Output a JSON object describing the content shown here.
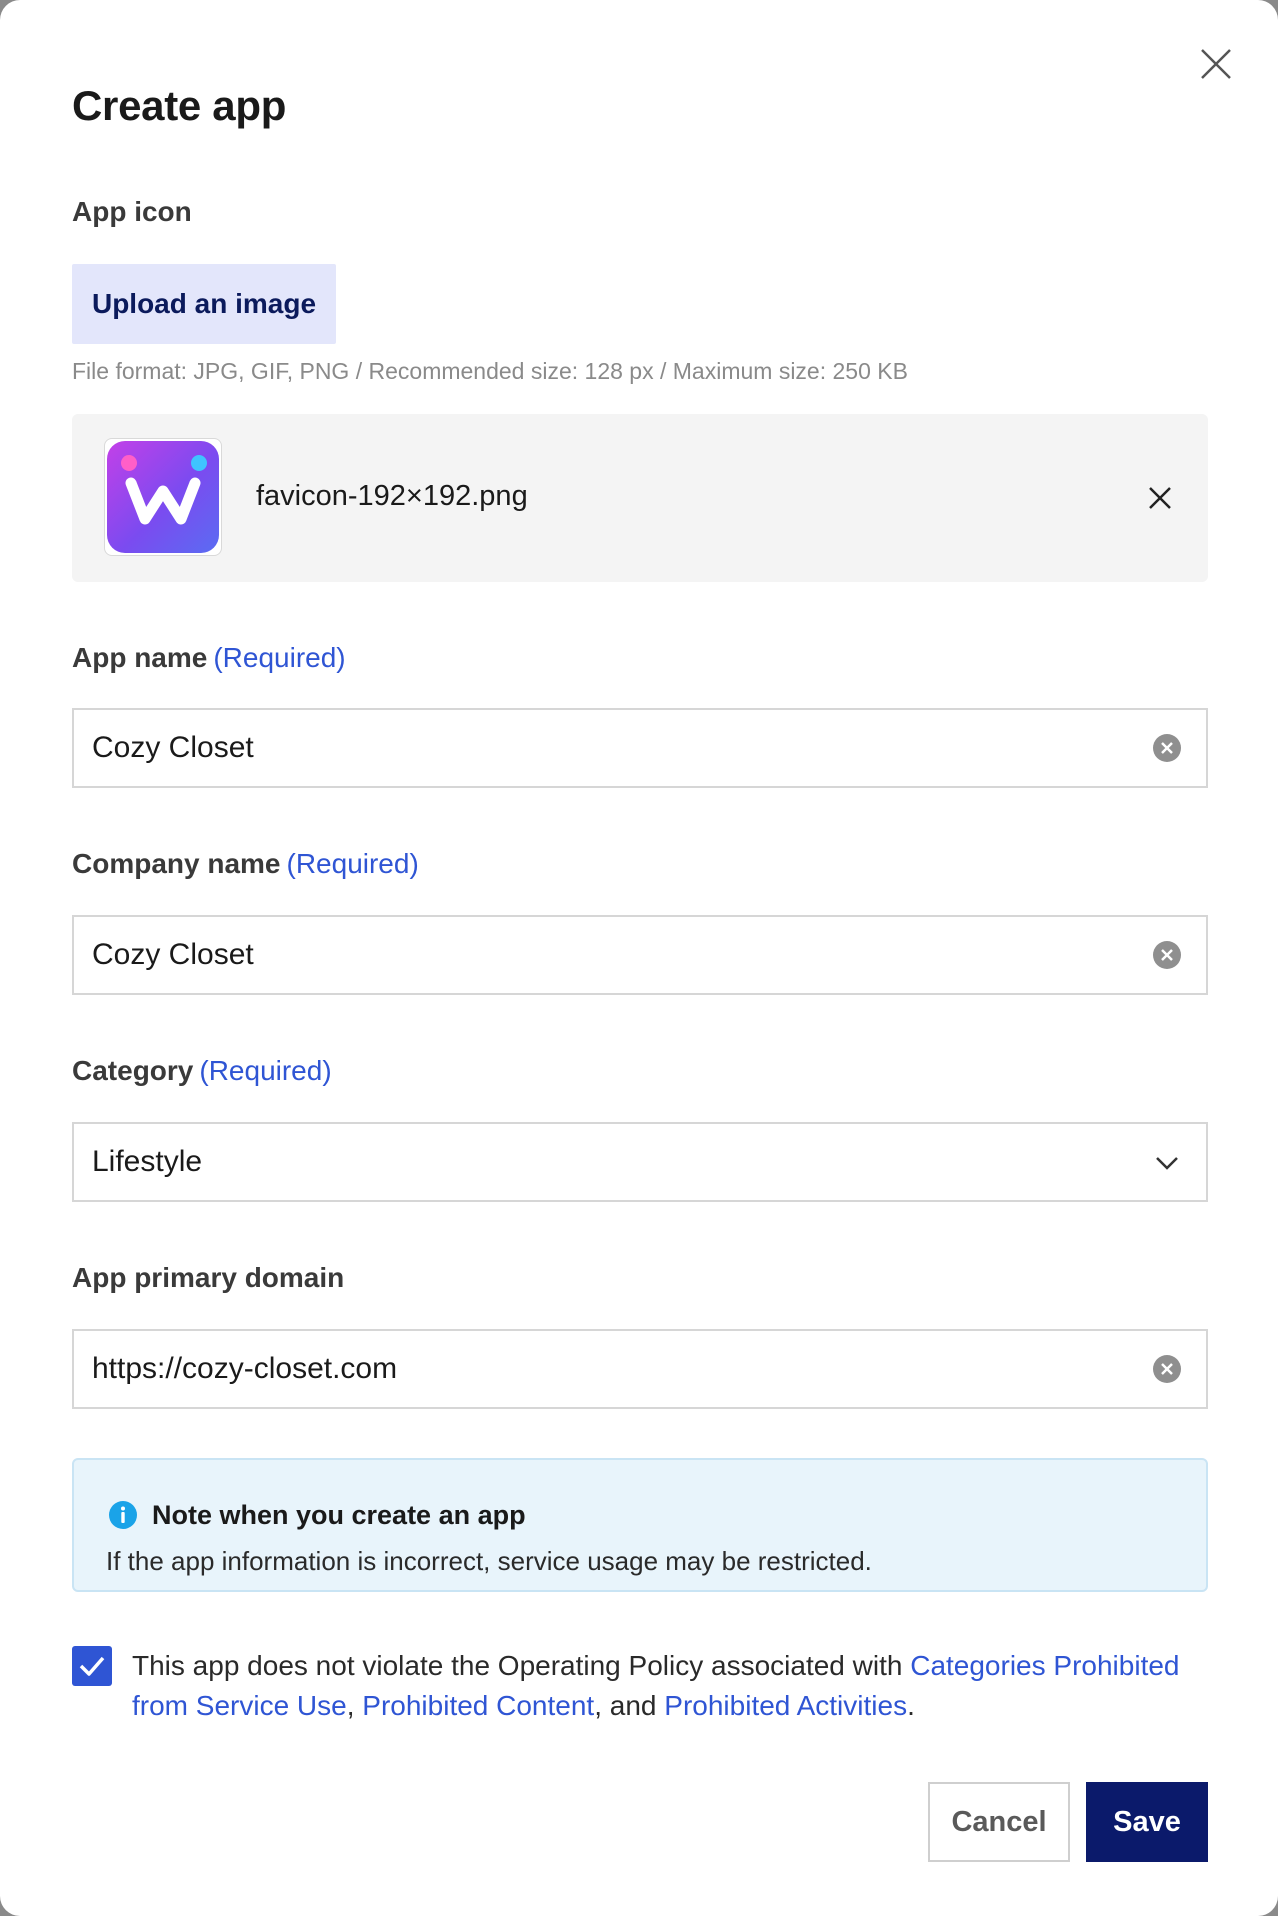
{
  "dialog": {
    "title": "Create app"
  },
  "app_icon": {
    "label": "App icon",
    "upload_label": "Upload an image",
    "hint": "File format: JPG, GIF, PNG / Recommended size: 128 px / Maximum size: 250 KB",
    "file_name": "favicon-192×192.png"
  },
  "app_name": {
    "label": "App name",
    "required": "(Required)",
    "value": "Cozy Closet"
  },
  "company_name": {
    "label": "Company name",
    "required": "(Required)",
    "value": "Cozy Closet"
  },
  "category": {
    "label": "Category",
    "required": "(Required)",
    "selected": "Lifestyle"
  },
  "domain": {
    "label": "App primary domain",
    "value": "https://cozy-closet.com"
  },
  "notice": {
    "title": "Note when you create an app",
    "body": "If the app information is incorrect, service usage may be restricted."
  },
  "agreement": {
    "checked": true,
    "text_before": "This app does not violate the Operating Policy associated with ",
    "link1": "Categories Prohibited from Service Use",
    "sep1": ", ",
    "link2": "Prohibited Content",
    "sep2": ", and ",
    "link3": "Prohibited Activities",
    "text_after": "."
  },
  "actions": {
    "cancel_label": "Cancel",
    "save_label": "Save"
  },
  "colors": {
    "accent": "#2f55d4",
    "primary_button": "#0b1a6b",
    "upload_bg": "#e3e6fb",
    "notice_bg": "#e8f4fb",
    "info_icon": "#1aa3e8"
  },
  "icons": {
    "close": "close-icon",
    "remove_file": "close-icon",
    "clear": "clear-circle-icon",
    "dropdown": "chevron-down-icon",
    "info": "info-icon",
    "check": "checkmark-icon"
  }
}
